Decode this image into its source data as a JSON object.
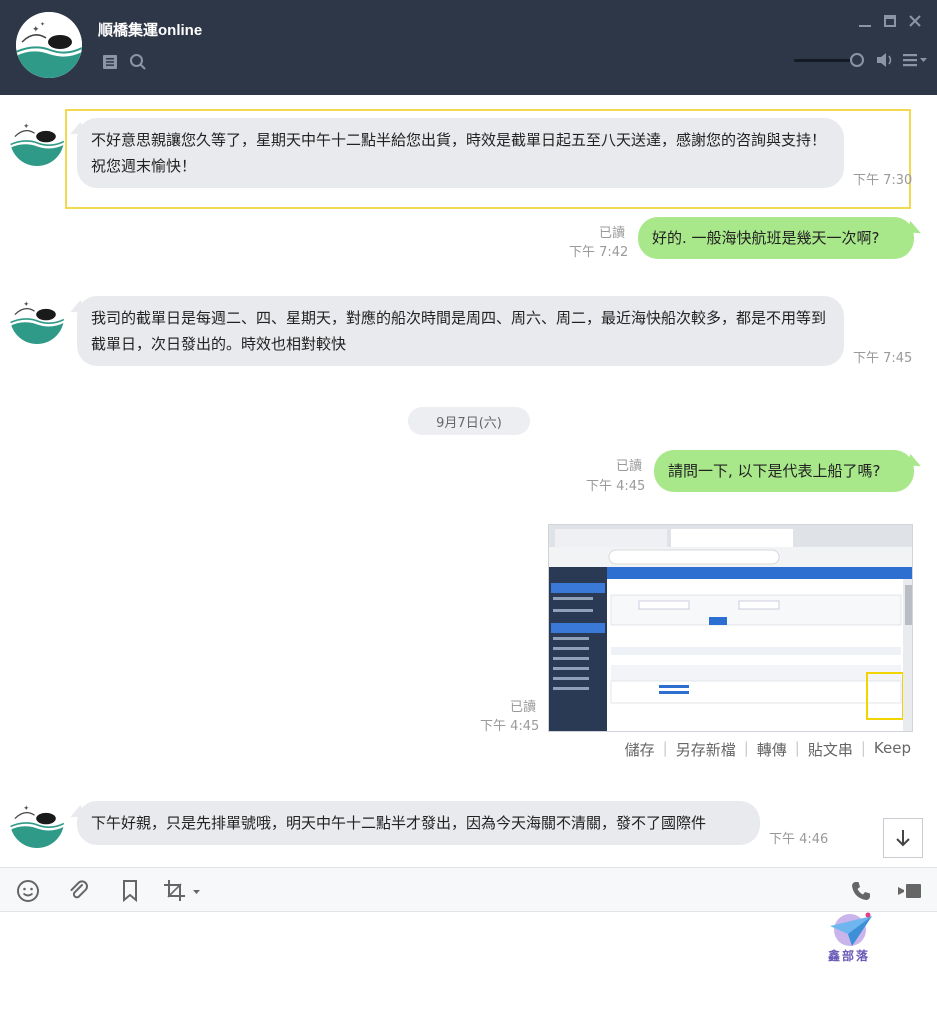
{
  "header": {
    "title": "順橋集運online",
    "colors": {
      "bg": "#2e3747",
      "icon": "#8c95a3"
    }
  },
  "messages": [
    {
      "side": "in",
      "text": "不好意思親讓您久等了，星期天中午十二點半給您出貨，時效是截單日起五至八天送達，感謝您的咨詢與支持！祝您週末愉快！",
      "time": "下午 7:30"
    },
    {
      "side": "out",
      "text": "好的. 一般海快航班是幾天一次啊?",
      "time": "下午 7:42",
      "read": "已讀"
    },
    {
      "side": "in",
      "text": "我司的截單日是每週二、四、星期天，對應的船次時間是周四、周六、周二，最近海快船次較多，都是不用等到截單日，次日發出的。時效也相對較快",
      "time": "下午 7:45"
    },
    {
      "side": "out",
      "text": "請問一下, 以下是代表上船了嗎?",
      "time": "下午 4:45",
      "read": "已讀"
    },
    {
      "side": "out-image",
      "time": "下午 4:45",
      "read": "已讀"
    },
    {
      "side": "in",
      "text": "下午好親，只是先排單號哦，明天中午十二點半才發出，因為今天海關不清關，發不了國際件",
      "time": "下午 4:46"
    }
  ],
  "date_divider": "9月7日(六)",
  "image_actions": [
    "儲存",
    "另存新檔",
    "轉傳",
    "貼文串",
    "Keep"
  ],
  "watermark": "鑫部落",
  "colors": {
    "bubble_in": "#e8eaed",
    "bubble_out": "#a8e88a",
    "highlight": "#f1d84e"
  }
}
